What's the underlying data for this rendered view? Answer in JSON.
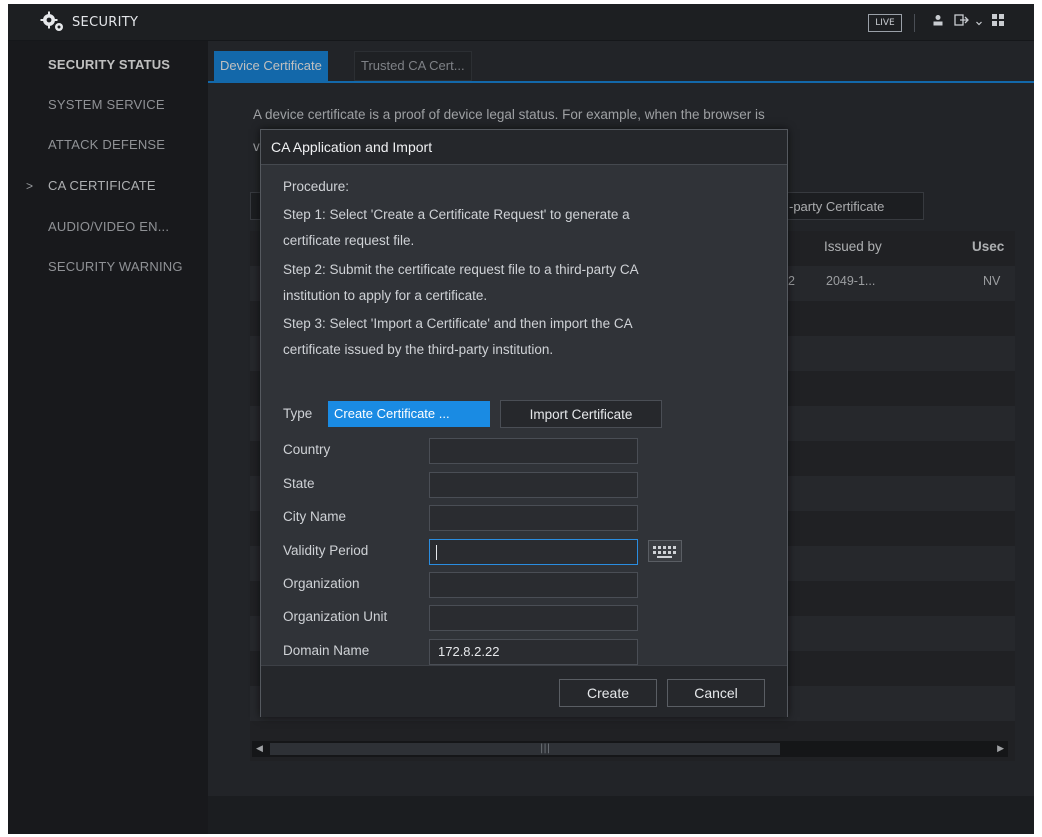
{
  "topbar": {
    "title": "SECURITY",
    "live_label": "LIVE",
    "icons": [
      "user-icon",
      "logout-icon",
      "grid-icon"
    ]
  },
  "sidebar": {
    "items": [
      {
        "label": "SECURITY STATUS"
      },
      {
        "label": "SYSTEM SERVICE"
      },
      {
        "label": "ATTACK DEFENSE"
      },
      {
        "label": "CA CERTIFICATE"
      },
      {
        "label": "AUDIO/VIDEO EN..."
      },
      {
        "label": "SECURITY WARNING"
      }
    ],
    "current_marker": ">"
  },
  "main": {
    "tabs": [
      {
        "label": "Device Certificate"
      },
      {
        "label": "Trusted CA Cert..."
      }
    ],
    "intro_line1": "A device certificate is a proof of device legal status. For example, when the browser is",
    "intro_line2_fragment": "v",
    "third_party_button": "-party Certificate",
    "table": {
      "headers": [
        "Issued by",
        "Usec"
      ],
      "row_fragments": [
        "2",
        "2049-1...",
        "NV"
      ]
    }
  },
  "dialog": {
    "title": "CA Application and Import",
    "procedure": [
      "Procedure:",
      " Step 1: Select 'Create a Certificate Request' to generate a",
      "certificate request file.",
      " Step 2: Submit the certificate request file to a third-party CA",
      "institution to apply for a certificate.",
      " Step 3: Select 'Import a Certificate' and then import the CA",
      "certificate issued by the third-party institution."
    ],
    "type_label": "Type",
    "type_options": [
      "Create Certificate ...",
      "Import Certificate"
    ],
    "fields": [
      {
        "label": "Country",
        "value": ""
      },
      {
        "label": "State",
        "value": ""
      },
      {
        "label": "City Name",
        "value": ""
      },
      {
        "label": "Validity Period",
        "value": ""
      },
      {
        "label": "Organization",
        "value": ""
      },
      {
        "label": "Organization Unit",
        "value": ""
      },
      {
        "label": "Domain Name",
        "value": "172.8.2.22"
      }
    ],
    "create_label": "Create",
    "cancel_label": "Cancel"
  },
  "colors": {
    "accent": "#1a8be3",
    "background": "#2e3136",
    "sidebar": "#202226"
  }
}
